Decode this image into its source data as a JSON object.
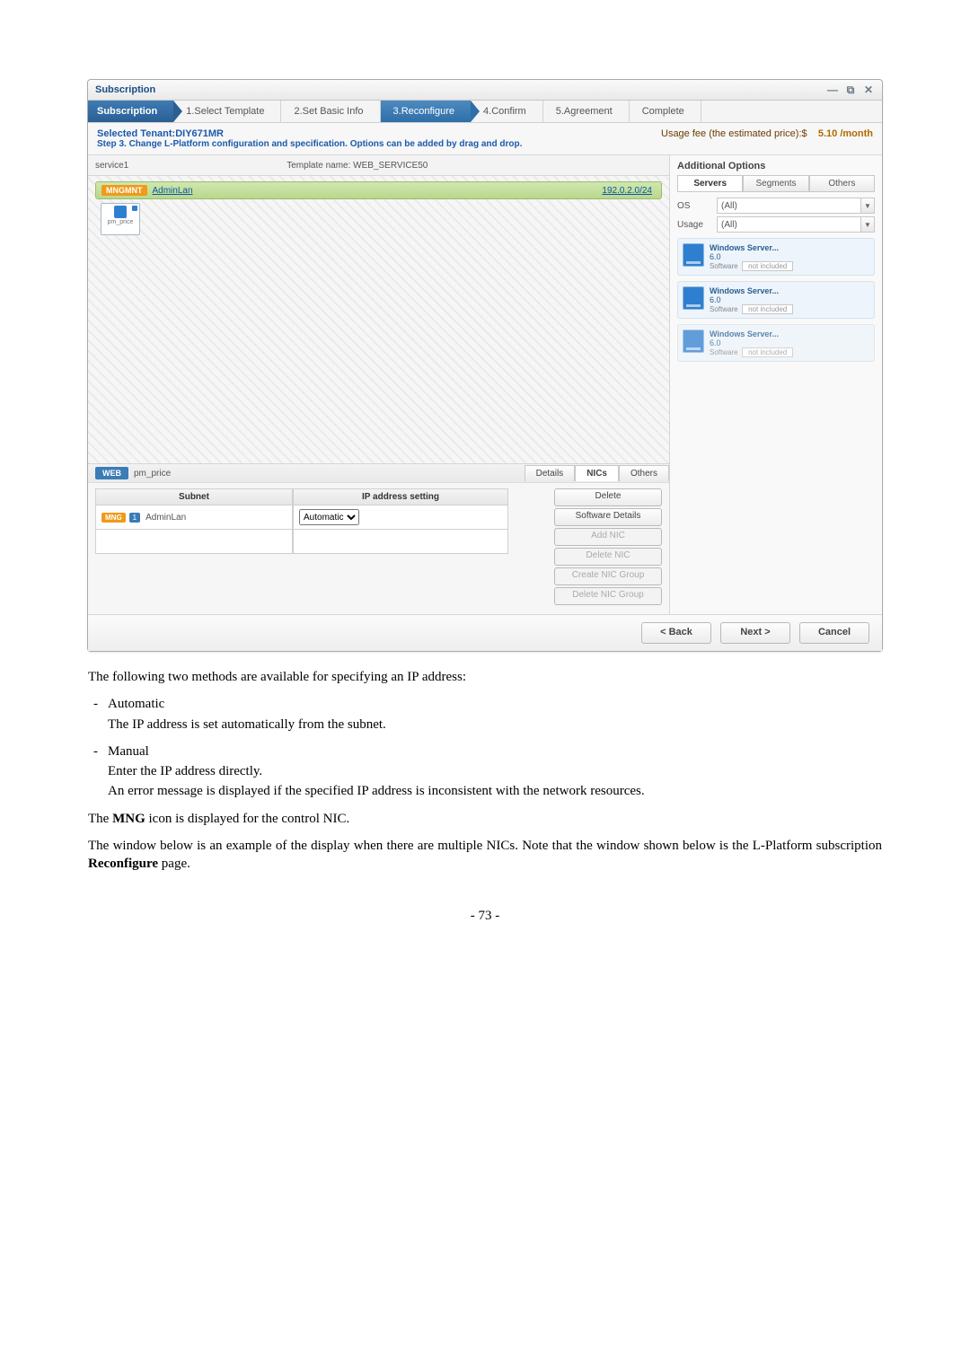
{
  "window": {
    "title": "Subscription"
  },
  "wizard": {
    "root": "Subscription",
    "steps": [
      "1.Select Template",
      "2.Set Basic Info",
      "3.Reconfigure",
      "4.Confirm",
      "5.Agreement",
      "Complete"
    ]
  },
  "info": {
    "tenant_label": "Selected Tenant:DIY671MR",
    "step_desc": "Step 3. Change L-Platform configuration and specification. Options can be added by drag and drop.",
    "fee_label": "Usage fee (the estimated price):$",
    "fee_value": "5.10 /month"
  },
  "service": {
    "name": "service1",
    "template_label": "Template name: WEB_SERVICE50"
  },
  "segment": {
    "tag": "MNGMNT",
    "name": "AdminLan",
    "ip": "192.0.2.0/24",
    "server_label": "pm_price"
  },
  "nicpanel": {
    "tag": "WEB",
    "srv": "pm_price",
    "tabs": [
      "Details",
      "NICs",
      "Others"
    ],
    "col_subnet": "Subnet",
    "col_ip": "IP address setting",
    "row_mng": "MNG",
    "row_idx": "1",
    "row_subnet": "AdminLan",
    "row_mode": "Automatic",
    "btns": [
      "Delete",
      "Software Details",
      "Add NIC",
      "Delete NIC",
      "Create NIC Group",
      "Delete NIC Group"
    ]
  },
  "sidebar": {
    "title": "Additional Options",
    "tabs": [
      "Servers",
      "Segments",
      "Others"
    ],
    "os_label": "OS",
    "os_value": "(All)",
    "usage_label": "Usage",
    "usage_value": "(All)",
    "cards": [
      {
        "name": "Windows Server...",
        "ver": "6.0",
        "sw_label": "Software",
        "sw_val": "not included"
      },
      {
        "name": "Windows Server...",
        "ver": "6.0",
        "sw_label": "Software",
        "sw_val": "not included"
      },
      {
        "name": "Windows Server...",
        "ver": "6.0",
        "sw_label": "Software",
        "sw_val": "not included"
      }
    ]
  },
  "footer": {
    "back": "< Back",
    "next": "Next >",
    "cancel": "Cancel"
  },
  "doc": {
    "intro": "The following two methods are available for specifying an IP address:",
    "auto_h": "Automatic",
    "auto_d": "The IP address is set automatically from the subnet.",
    "man_h": "Manual",
    "man_d1": "Enter the IP address directly.",
    "man_d2": "An error message is displayed if the specified IP address is inconsistent with the network resources.",
    "mng1": "The ",
    "mng_b": "MNG",
    "mng2": " icon is displayed for the control NIC.",
    "win1": "The window below is an example of the display when there are multiple NICs. Note that the window shown below is the L-Platform subscription ",
    "win_b": "Reconfigure",
    "win2": " page.",
    "page": "- 73 -"
  }
}
